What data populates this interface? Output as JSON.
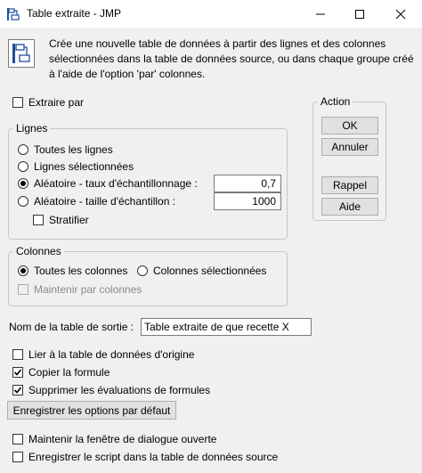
{
  "window": {
    "title": "Table extraite - JMP",
    "icon": "table-split-icon",
    "controls": [
      "minimize-icon",
      "maximize-icon",
      "close-icon"
    ]
  },
  "description": "Crée une nouvelle table de données à partir des lignes et des colonnes sélectionnées dans la table de données source, ou dans chaque groupe créé à l'aide de l'option 'par' colonnes.",
  "extract_by": {
    "label": "Extraire par",
    "checked": false
  },
  "rows_group": {
    "title": "Lignes",
    "options": [
      {
        "label": "Toutes les lignes",
        "selected": false
      },
      {
        "label": "Lignes sélectionnées",
        "selected": false
      },
      {
        "label": "Aléatoire - taux d'échantillonnage :",
        "selected": true,
        "value": "0,7"
      },
      {
        "label": "Aléatoire - taille d'échantillon :",
        "selected": false,
        "value": "1000"
      }
    ],
    "stratify": {
      "label": "Stratifier",
      "checked": false
    }
  },
  "columns_group": {
    "title": "Colonnes",
    "options": [
      {
        "label": "Toutes les colonnes",
        "selected": true
      },
      {
        "label": "Colonnes sélectionnées",
        "selected": false
      }
    ],
    "keep_by_columns": {
      "label": "Maintenir par colonnes",
      "checked": false,
      "disabled": true
    }
  },
  "action": {
    "title": "Action",
    "ok": "OK",
    "cancel": "Annuler",
    "recall": "Rappel",
    "help": "Aide"
  },
  "output_name": {
    "label": "Nom de la table de sortie :",
    "value": "Table extraite de que recette X"
  },
  "options": [
    {
      "label": "Lier à la table de données d'origine",
      "checked": false
    },
    {
      "label": "Copier la formule",
      "checked": true
    },
    {
      "label": "Supprimer les évaluations de formules",
      "checked": true
    }
  ],
  "save_defaults_button": "Enregistrer les options par défaut",
  "bottom_options": [
    {
      "label": "Maintenir la fenêtre de dialogue ouverte",
      "checked": false
    },
    {
      "label": "Enregistrer le script dans la table de données source",
      "checked": false
    }
  ]
}
